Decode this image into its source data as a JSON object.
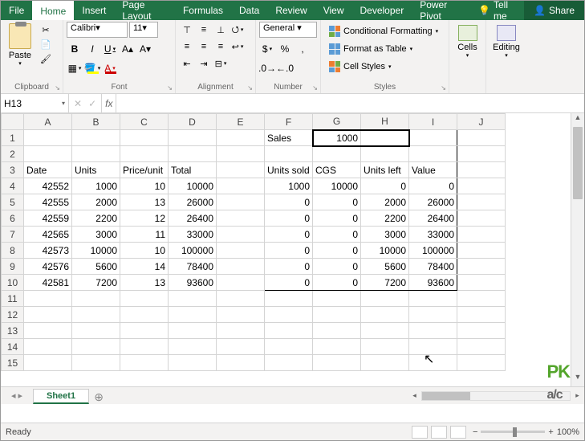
{
  "tabs": [
    "File",
    "Home",
    "Insert",
    "Page Layout",
    "Formulas",
    "Data",
    "Review",
    "View",
    "Developer",
    "Power Pivot"
  ],
  "active_tab": "Home",
  "tell_me": "Tell me",
  "share": "Share",
  "ribbon": {
    "clipboard": {
      "label": "Clipboard",
      "paste": "Paste"
    },
    "font": {
      "label": "Font",
      "name": "Calibri",
      "size": "11"
    },
    "alignment": {
      "label": "Alignment"
    },
    "number": {
      "label": "Number",
      "format": "General"
    },
    "styles": {
      "label": "Styles",
      "cond_fmt": "Conditional Formatting",
      "as_table": "Format as Table",
      "cell_styles": "Cell Styles"
    },
    "cells": {
      "label": "Cells",
      "btn": "Cells"
    },
    "editing": {
      "label": "Editing",
      "btn": "Editing"
    }
  },
  "name_box": "H13",
  "fx_label": "fx",
  "formula": "",
  "columns": [
    "A",
    "B",
    "C",
    "D",
    "E",
    "F",
    "G",
    "H",
    "I",
    "J"
  ],
  "rows_count": 15,
  "cells": {
    "F1": "Sales",
    "G1": "1000",
    "A3": "Date",
    "B3": "Units",
    "C3": "Price/unit",
    "D3": "Total",
    "F3": "Units sold",
    "G3": "CGS",
    "H3": "Units left",
    "I3": "Value",
    "A4": "42552",
    "B4": "1000",
    "C4": "10",
    "D4": "10000",
    "F4": "1000",
    "G4": "10000",
    "H4": "0",
    "I4": "0",
    "A5": "42555",
    "B5": "2000",
    "C5": "13",
    "D5": "26000",
    "F5": "0",
    "G5": "0",
    "H5": "2000",
    "I5": "26000",
    "A6": "42559",
    "B6": "2200",
    "C6": "12",
    "D6": "26400",
    "F6": "0",
    "G6": "0",
    "H6": "2200",
    "I6": "26400",
    "A7": "42565",
    "B7": "3000",
    "C7": "11",
    "D7": "33000",
    "F7": "0",
    "G7": "0",
    "H7": "3000",
    "I7": "33000",
    "A8": "42573",
    "B8": "10000",
    "C8": "10",
    "D8": "100000",
    "F8": "0",
    "G8": "0",
    "H8": "10000",
    "I8": "100000",
    "A9": "42576",
    "B9": "5600",
    "C9": "14",
    "D9": "78400",
    "F9": "0",
    "G9": "0",
    "H9": "5600",
    "I9": "78400",
    "A10": "42581",
    "B10": "7200",
    "C10": "13",
    "D10": "93600",
    "F10": "0",
    "G10": "0",
    "H10": "7200",
    "I10": "93600"
  },
  "text_cells": [
    "F1",
    "A3",
    "B3",
    "C3",
    "D3",
    "F3",
    "G3",
    "H3",
    "I3"
  ],
  "bordered_box": [
    "G1",
    "H1"
  ],
  "sheet_tab": "Sheet1",
  "status": "Ready",
  "zoom": "100%",
  "watermark": {
    "top": "PK",
    "bottom": "a/c"
  },
  "chart_data": {
    "type": "table",
    "title": "Sales",
    "input_value": 1000,
    "columns_left": [
      "Date",
      "Units",
      "Price/unit",
      "Total"
    ],
    "columns_right": [
      "Units sold",
      "CGS",
      "Units left",
      "Value"
    ],
    "rows": [
      {
        "Date": 42552,
        "Units": 1000,
        "Price/unit": 10,
        "Total": 10000,
        "Units sold": 1000,
        "CGS": 10000,
        "Units left": 0,
        "Value": 0
      },
      {
        "Date": 42555,
        "Units": 2000,
        "Price/unit": 13,
        "Total": 26000,
        "Units sold": 0,
        "CGS": 0,
        "Units left": 2000,
        "Value": 26000
      },
      {
        "Date": 42559,
        "Units": 2200,
        "Price/unit": 12,
        "Total": 26400,
        "Units sold": 0,
        "CGS": 0,
        "Units left": 2200,
        "Value": 26400
      },
      {
        "Date": 42565,
        "Units": 3000,
        "Price/unit": 11,
        "Total": 33000,
        "Units sold": 0,
        "CGS": 0,
        "Units left": 3000,
        "Value": 33000
      },
      {
        "Date": 42573,
        "Units": 10000,
        "Price/unit": 10,
        "Total": 100000,
        "Units sold": 0,
        "CGS": 0,
        "Units left": 10000,
        "Value": 100000
      },
      {
        "Date": 42576,
        "Units": 5600,
        "Price/unit": 14,
        "Total": 78400,
        "Units sold": 0,
        "CGS": 0,
        "Units left": 5600,
        "Value": 78400
      },
      {
        "Date": 42581,
        "Units": 7200,
        "Price/unit": 13,
        "Total": 93600,
        "Units sold": 0,
        "CGS": 0,
        "Units left": 7200,
        "Value": 93600
      }
    ]
  }
}
